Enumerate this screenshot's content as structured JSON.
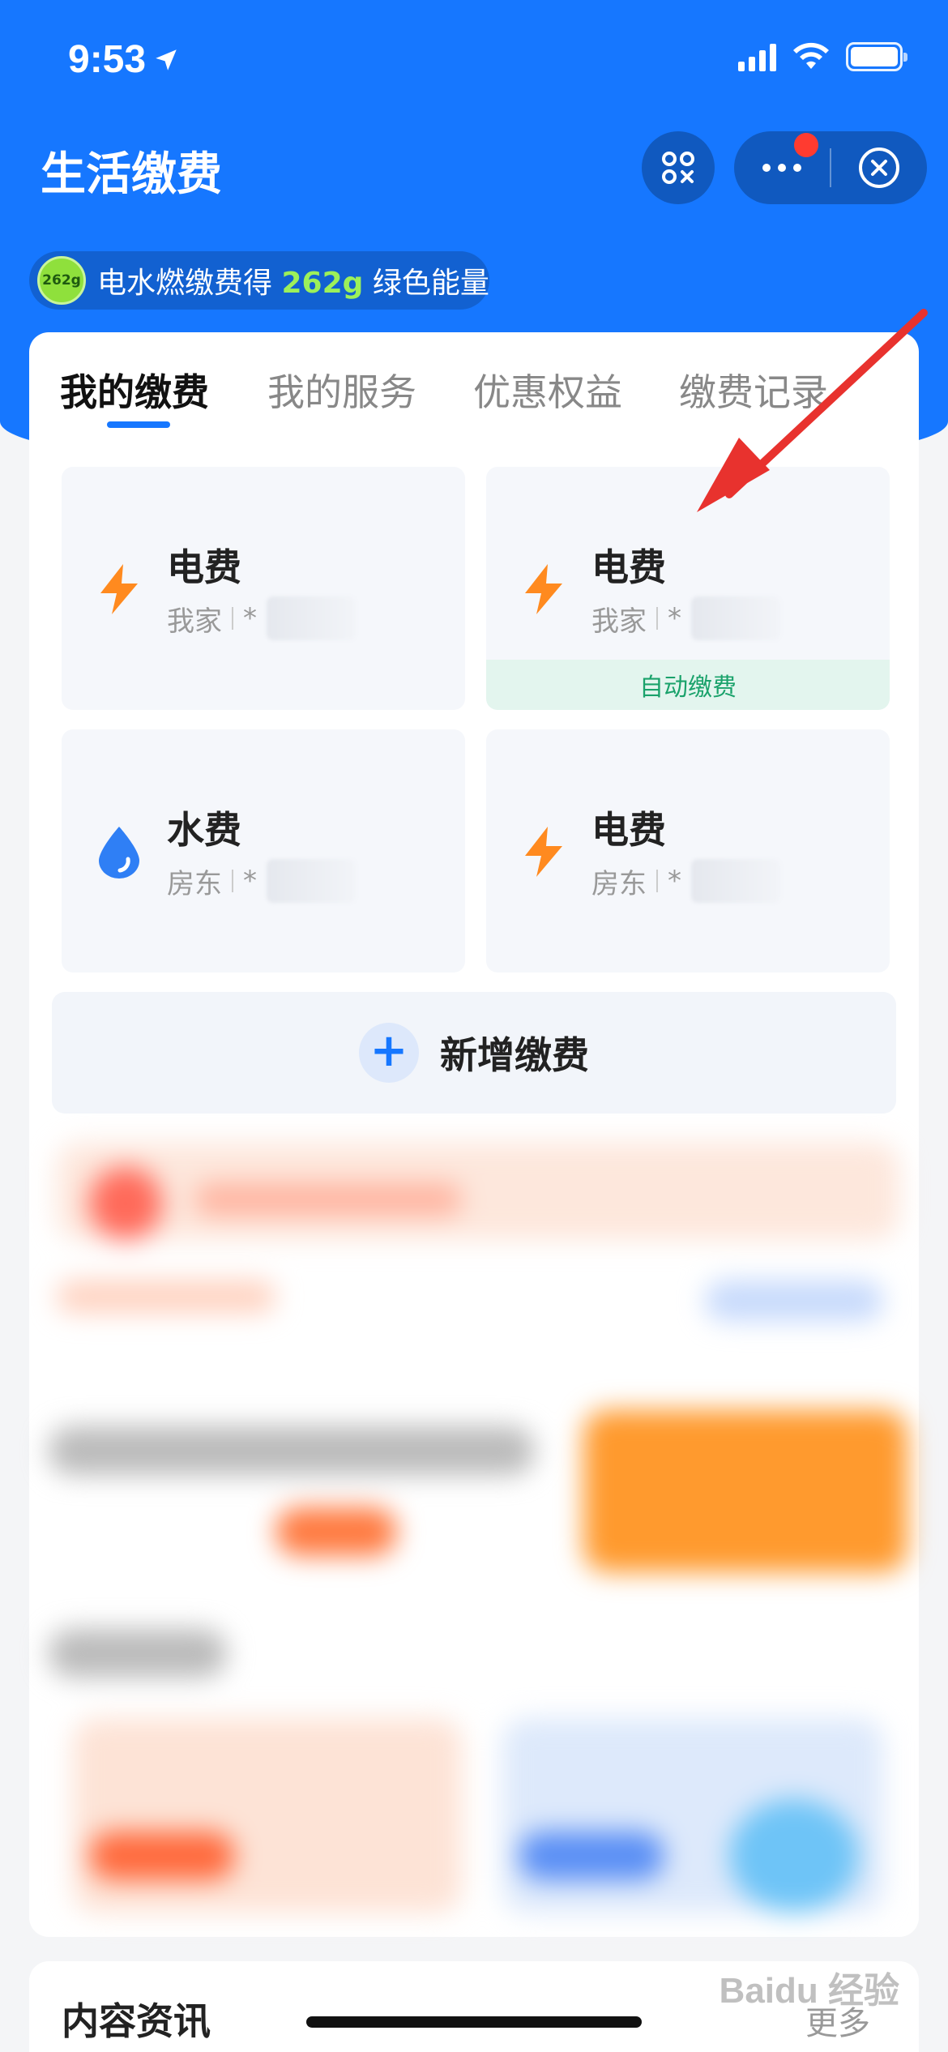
{
  "status_bar": {
    "time": "9:53"
  },
  "header": {
    "title": "生活缴费",
    "energy_prefix": "电水燃缴费得",
    "energy_amount": "262g",
    "energy_suffix": "绿色能量",
    "energy_badge": "262g"
  },
  "tabs": [
    {
      "label": "我的缴费",
      "active": true
    },
    {
      "label": "我的服务",
      "active": false
    },
    {
      "label": "优惠权益",
      "active": false
    },
    {
      "label": "缴费记录",
      "active": false
    }
  ],
  "bills": [
    {
      "name": "电费",
      "owner": "我家",
      "account": "*",
      "icon": "lightning-icon",
      "auto_pay": ""
    },
    {
      "name": "电费",
      "owner": "我家",
      "account": "*",
      "icon": "lightning-icon",
      "auto_pay": "自动缴费"
    },
    {
      "name": "水费",
      "owner": "房东",
      "account": "*",
      "icon": "water-drop-icon",
      "auto_pay": ""
    },
    {
      "name": "电费",
      "owner": "房东",
      "account": "*",
      "icon": "lightning-icon",
      "auto_pay": ""
    }
  ],
  "add_button": {
    "label": "新增缴费"
  },
  "content_section": {
    "title": "内容资讯",
    "more": "更多"
  },
  "watermark": "Baidu 经验",
  "colors": {
    "brand_blue": "#1677ff",
    "lightning_orange": "#ff8a1f",
    "auto_green": "#1aa26b",
    "annotation_red": "#e8322e"
  }
}
